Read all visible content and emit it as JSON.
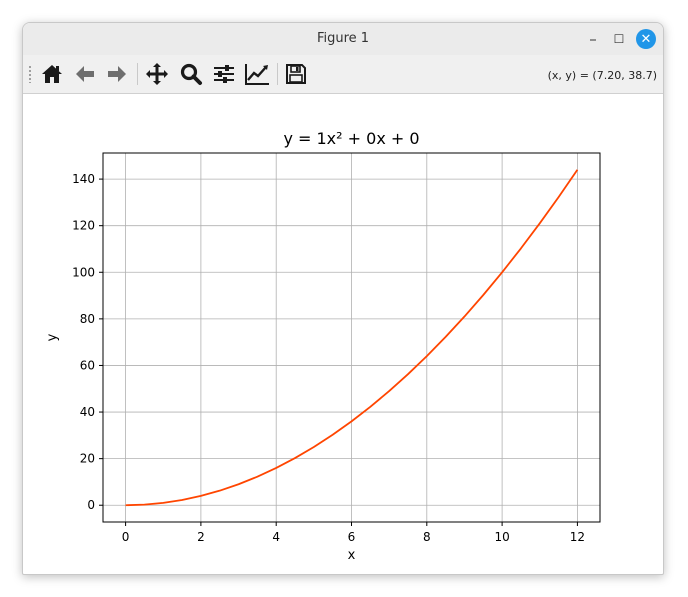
{
  "window": {
    "title": "Figure 1",
    "minimize_symbol": "⎯",
    "maximize_symbol": "☐",
    "close_symbol": "✕"
  },
  "toolbar": {
    "buttons": [
      {
        "name": "home-icon"
      },
      {
        "name": "back-icon"
      },
      {
        "name": "forward-icon"
      },
      {
        "name": "pan-icon"
      },
      {
        "name": "zoom-icon"
      },
      {
        "name": "configure-subplots-icon"
      },
      {
        "name": "edit-axes-icon"
      },
      {
        "name": "save-icon"
      }
    ],
    "coords": "(x, y) = (7.20, 38.7)"
  },
  "colors": {
    "line": "#ff4500",
    "grid": "#b0b0b0"
  },
  "chart_data": {
    "type": "line",
    "title": "y = 1x² + 0x + 0",
    "xlabel": "x",
    "ylabel": "y",
    "xlim": [
      -0.6,
      12.6
    ],
    "ylim": [
      -7.2,
      151.2
    ],
    "xticks": [
      0,
      2,
      4,
      6,
      8,
      10,
      12
    ],
    "yticks": [
      0,
      20,
      40,
      60,
      80,
      100,
      120,
      140
    ],
    "grid": true,
    "series": [
      {
        "x": [
          0,
          0.5,
          1,
          1.5,
          2,
          2.5,
          3,
          3.5,
          4,
          4.5,
          5,
          5.5,
          6,
          6.5,
          7,
          7.5,
          8,
          8.5,
          9,
          9.5,
          10,
          10.5,
          11,
          11.5,
          12
        ],
        "y": [
          0,
          0.25,
          1,
          2.25,
          4,
          6.25,
          9,
          12.25,
          16,
          20.25,
          25,
          30.25,
          36,
          42.25,
          49,
          56.25,
          64,
          72.25,
          81,
          90.25,
          100,
          110.25,
          121,
          132.25,
          144
        ]
      }
    ]
  }
}
